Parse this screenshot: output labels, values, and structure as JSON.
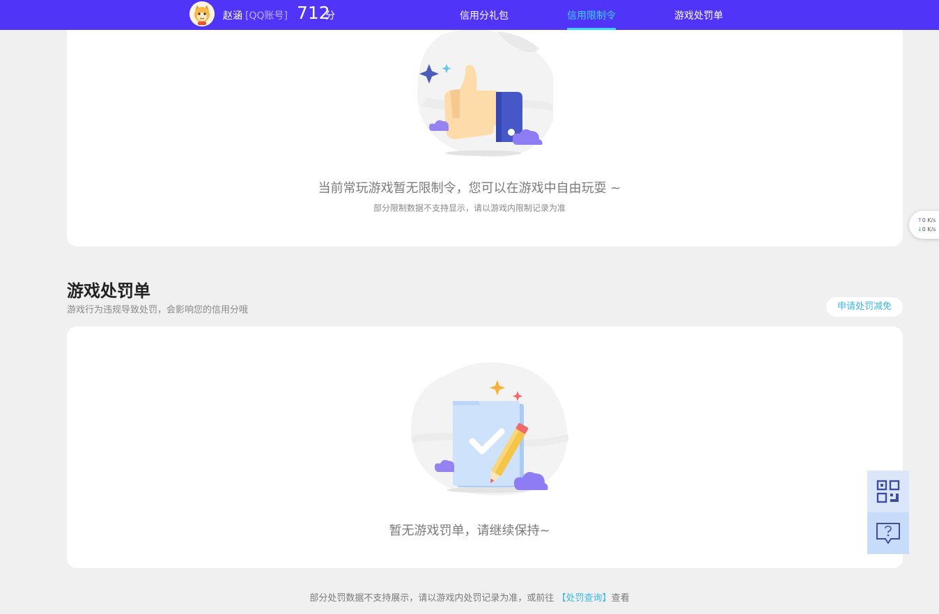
{
  "header": {
    "user_name": "赵涵",
    "account_type": "[QQ账号]",
    "score": "712",
    "score_unit": "分",
    "tabs": [
      {
        "label": "信用分礼包",
        "active": false
      },
      {
        "label": "信用限制令",
        "active": true
      },
      {
        "label": "游戏处罚单",
        "active": false
      }
    ]
  },
  "restriction": {
    "empty_title": "当前常玩游戏暂无限制令，您可以在游戏中自由玩耍 ~",
    "empty_note": "部分限制数据不支持显示，请以游戏内限制记录为准"
  },
  "penalty": {
    "title": "游戏处罚单",
    "description": "游戏行为违规导致处罚，会影响您的信用分哦",
    "appeal_button": "申请处罚减免",
    "empty_title": "暂无游戏罚单，请继续保持~"
  },
  "footer": {
    "note": "部分处罚数据不支持展示，请以游戏内处罚记录为准，或前往 ",
    "link": "【处罚查询】",
    "suffix": "查看"
  },
  "net_speed": {
    "up_arrow": "↑",
    "up": "0  K/s",
    "down_arrow": "↓",
    "down": "0  K/s"
  },
  "floating": {
    "qr_icon": "qr-code-icon",
    "help_icon": "help-bubble-icon"
  },
  "colors": {
    "header_bg": "#5034f7",
    "active_tab": "#38d3ff",
    "link": "#3ab9e8",
    "page_bg": "#f0f0f0"
  }
}
